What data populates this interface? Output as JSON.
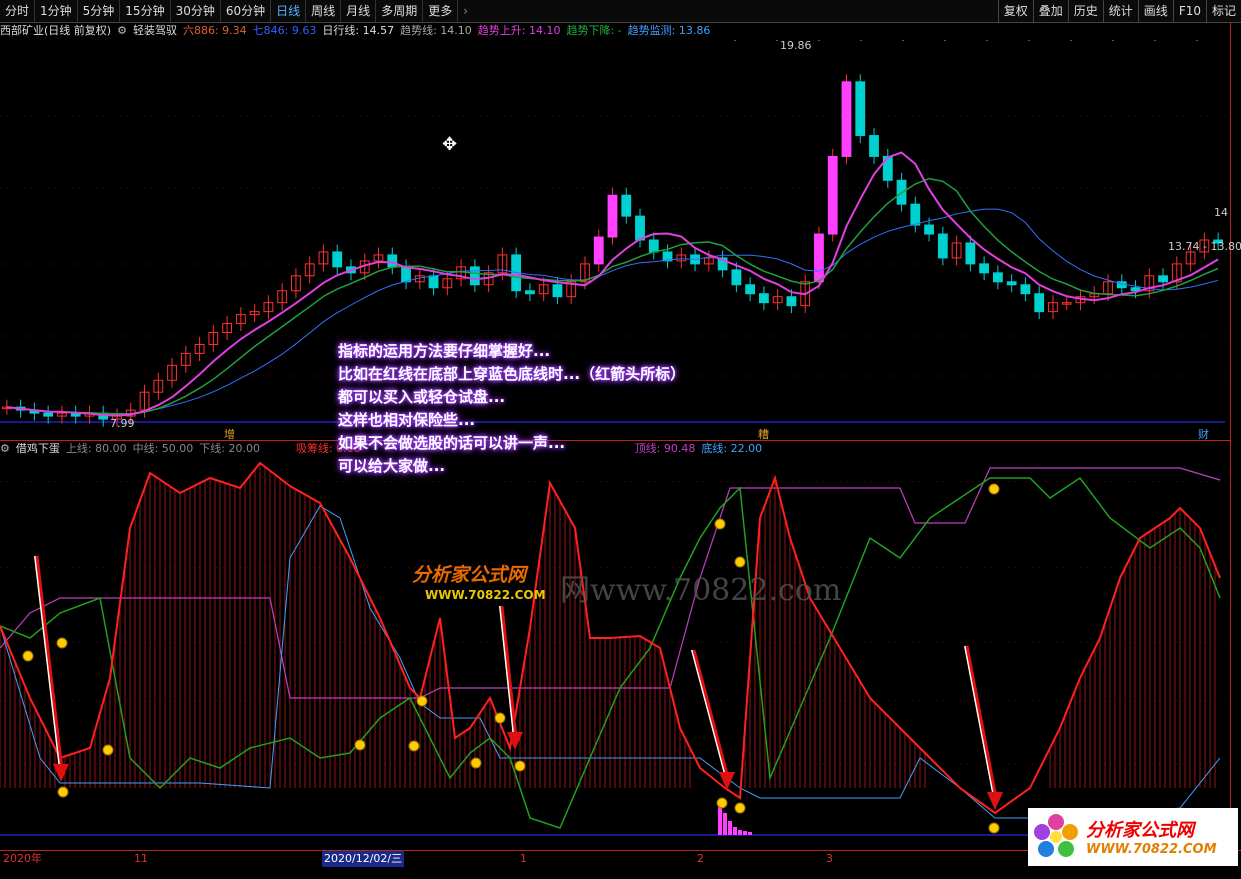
{
  "toolbar": {
    "tabs": [
      "分时",
      "1分钟",
      "5分钟",
      "15分钟",
      "30分钟",
      "60分钟",
      "日线",
      "周线",
      "月线",
      "多周期",
      "更多"
    ],
    "right": [
      "复权",
      "叠加",
      "历史",
      "统计",
      "画线",
      "F10",
      "标记"
    ]
  },
  "info_main": {
    "stock": "西部矿业(日线 前复权)",
    "indicator": "轻装驾驭",
    "ma6": "六886: 9.34",
    "ma7": "七846: 9.63",
    "dayline": "日行线: 14.57",
    "trend": "趋势线: 14.10",
    "up": "趋势上升: 14.10",
    "down": "趋势下降: -",
    "monitor": "趋势监测: 13.86"
  },
  "info_ind": {
    "name": "借鸡下蛋",
    "upper": "上线: 80.00",
    "mid": "中线: 50.00",
    "lower": "下线: 20.00",
    "absorb": "吸筹线: 0.00",
    "top": "顶线: 90.48",
    "bottom": "底线: 22.00"
  },
  "price_labels": {
    "high": "19.86",
    "low": "7.99",
    "right1": "14",
    "right2": "13.74 - 13.80"
  },
  "markers": {
    "m1": "增",
    "m2": "糟",
    "m3": "财"
  },
  "annotation": [
    "指标的运用方法要仔细掌握好...",
    "比如在红线在底部上穿蓝色底线时...（红箭头所标）",
    "都可以买入或轻仓试盘...",
    "这样也相对保险些...",
    "如果不会做选股的话可以讲一声...",
    "可以给大家做..."
  ],
  "axis": {
    "l1": "2020年",
    "l2": "11",
    "l3": "2020/12/02/三",
    "l4": "1",
    "l5": "2",
    "l6": "3"
  },
  "watermark": {
    "cn": "分析家公式网",
    "url": "www.70822.com",
    "url2": "WWW.70822.COM",
    "big": "网www.70822.com"
  },
  "logo": {
    "cn": "分析家公式网",
    "url": "WWW.70822.COM"
  },
  "colors": {
    "up": "#ff3030",
    "down": "#00d0d0",
    "ma_pink": "#e040e0",
    "ma_green": "#20a040",
    "ma_blue": "#3070ff",
    "ind_red": "#ff2020",
    "ind_green": "#20a020",
    "ind_blue": "#40a0ff",
    "ind_pink": "#c040c0"
  },
  "chart_data": {
    "type": "candlestick",
    "main_closes": [
      8.4,
      8.3,
      8.2,
      8.1,
      8.2,
      8.1,
      8.2,
      8.0,
      8.1,
      8.3,
      8.9,
      9.3,
      9.8,
      10.2,
      10.5,
      10.9,
      11.2,
      11.5,
      11.6,
      11.9,
      12.3,
      12.8,
      13.2,
      13.6,
      13.1,
      12.9,
      13.3,
      13.5,
      13.1,
      12.6,
      12.8,
      12.4,
      12.7,
      13.1,
      12.5,
      12.9,
      13.5,
      12.3,
      12.2,
      12.5,
      12.1,
      12.6,
      13.2,
      14.1,
      15.5,
      14.8,
      14.0,
      13.6,
      13.3,
      13.5,
      13.2,
      13.4,
      13.0,
      12.5,
      12.2,
      11.9,
      12.1,
      11.8,
      12.6,
      14.2,
      16.8,
      19.3,
      17.5,
      16.8,
      16.0,
      15.2,
      14.5,
      14.2,
      13.4,
      13.9,
      13.2,
      12.9,
      12.6,
      12.5,
      12.2,
      11.6,
      11.9,
      11.9,
      12.1,
      12.2,
      12.6,
      12.4,
      12.3,
      12.8,
      12.6,
      13.2,
      13.6,
      14.0,
      13.9
    ]
  }
}
